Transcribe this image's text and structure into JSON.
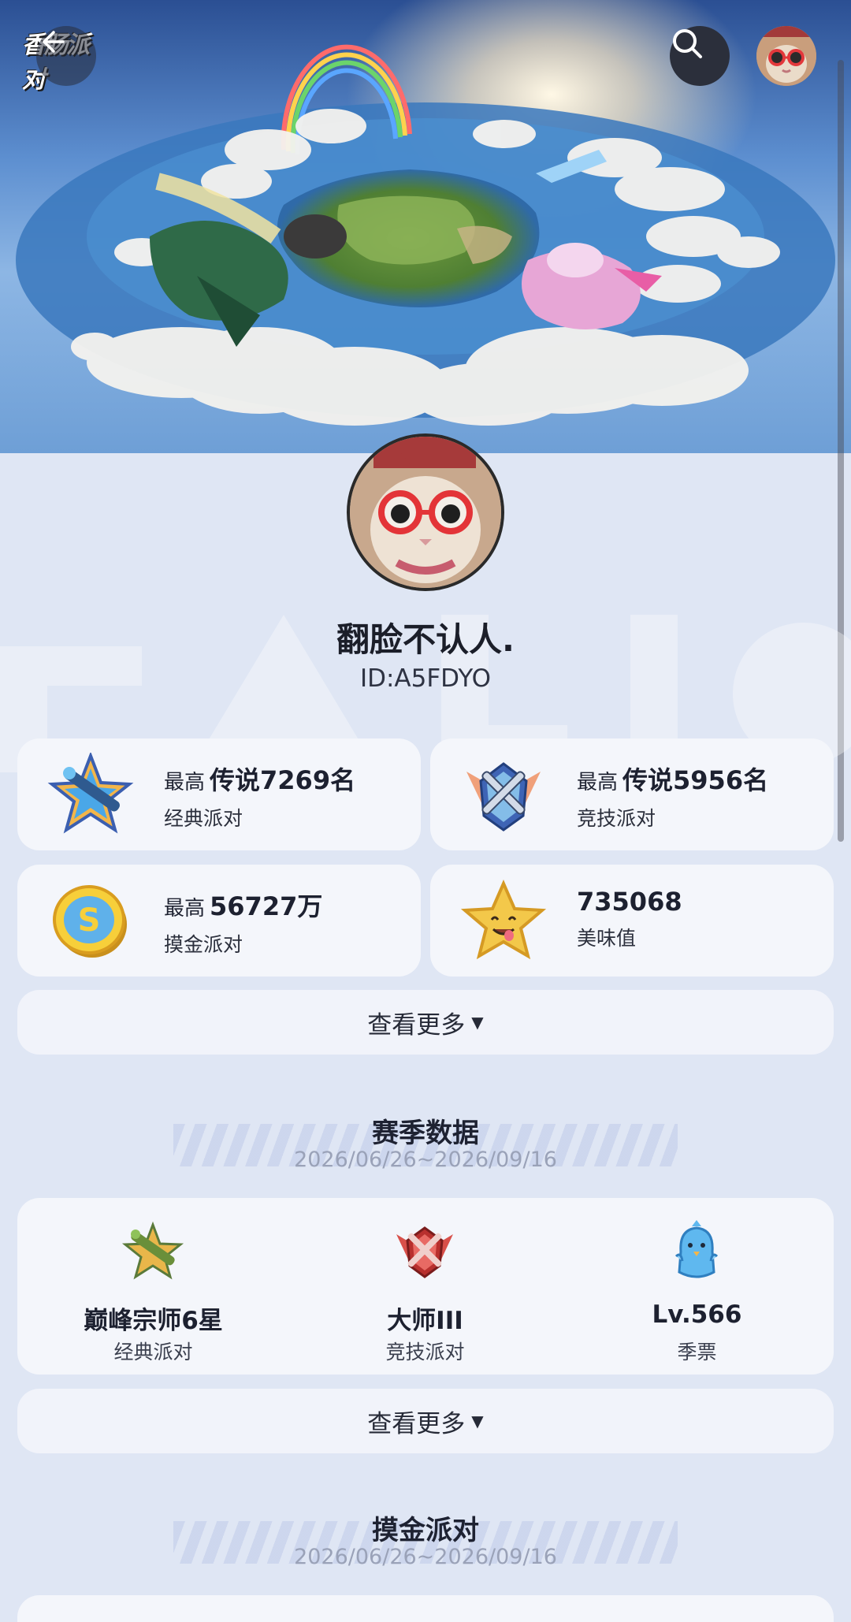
{
  "header": {
    "logo_text": "香肠派对",
    "icons": {
      "back": "back-arrow-icon",
      "search": "search-icon"
    }
  },
  "profile": {
    "name": "翻脸不认人.",
    "id": "ID:A5FDYO"
  },
  "stats": [
    {
      "prefix": "最高",
      "value": "传说7269名",
      "label": "经典派对",
      "icon": "classic-rank-icon"
    },
    {
      "prefix": "最高",
      "value": "传说5956名",
      "label": "竞技派对",
      "icon": "competitive-rank-icon"
    },
    {
      "prefix": "最高",
      "value": "56727万",
      "label": "摸金派对",
      "icon": "gold-coin-icon"
    },
    {
      "prefix": "",
      "value": "735068",
      "label": "美味值",
      "icon": "star-face-icon"
    }
  ],
  "more_label": "查看更多",
  "season": {
    "title": "赛季数据",
    "date": "2026/06/26~2026/09/16",
    "items": [
      {
        "value": "巅峰宗师6星",
        "label": "经典派对",
        "icon": "classic-rank-icon"
      },
      {
        "value": "大师III",
        "label": "竞技派对",
        "icon": "master-rank-icon"
      },
      {
        "value": "Lv.566",
        "label": "季票",
        "icon": "season-pass-chick-icon"
      }
    ]
  },
  "gold_section": {
    "title": "摸金派对",
    "date": "2026/06/26~2026/09/16"
  },
  "colors": {
    "background": "#dfe6f4",
    "card": "#f4f6fb",
    "text_primary": "#1d2130",
    "text_muted": "#9aa2b8"
  }
}
